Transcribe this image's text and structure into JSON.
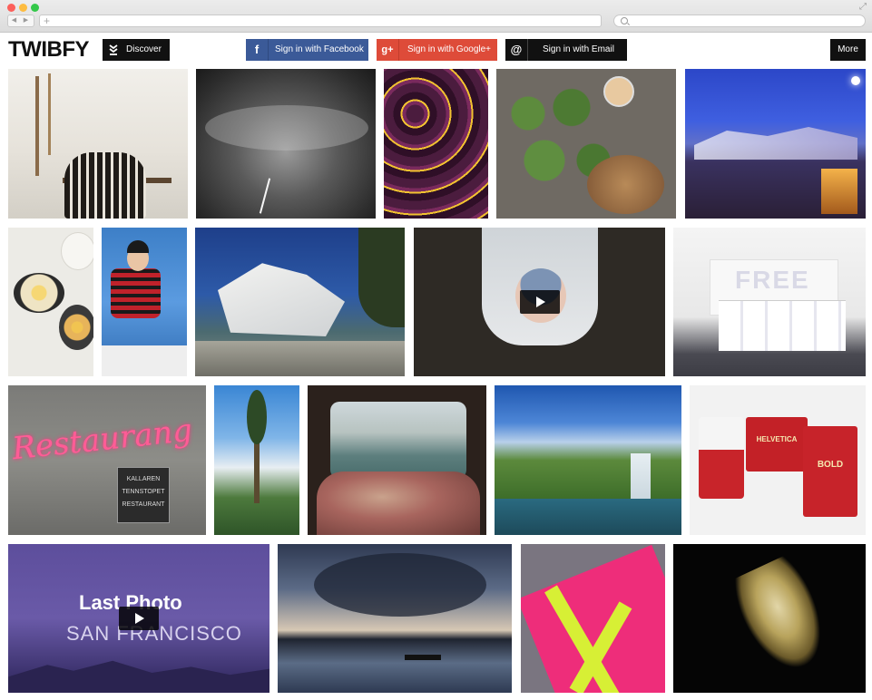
{
  "header": {
    "logo": "TWIBFY",
    "discover_label": "Discover",
    "facebook_label": "Sign in with Facebook",
    "facebook_icon": "f",
    "google_label": "Sign in with Google+",
    "google_icon": "g+",
    "email_label": "Sign in with Email",
    "email_icon": "@",
    "more_label": "More"
  },
  "photos": {
    "restaurant_sign": "Restaurang",
    "restaurant_plate": [
      "KALLAREN",
      "TENNSTOPET",
      "RESTAURANT"
    ],
    "last_photo_title": "Last Photo",
    "last_photo_subtitle": "SAN FRANCISCO",
    "box_label_1": "HELVETICA",
    "box_label_2": "BOLD",
    "office_wall_text": "FREE"
  },
  "colors": {
    "facebook": "#3b5a98",
    "google": "#de4b39",
    "dark": "#111111"
  }
}
